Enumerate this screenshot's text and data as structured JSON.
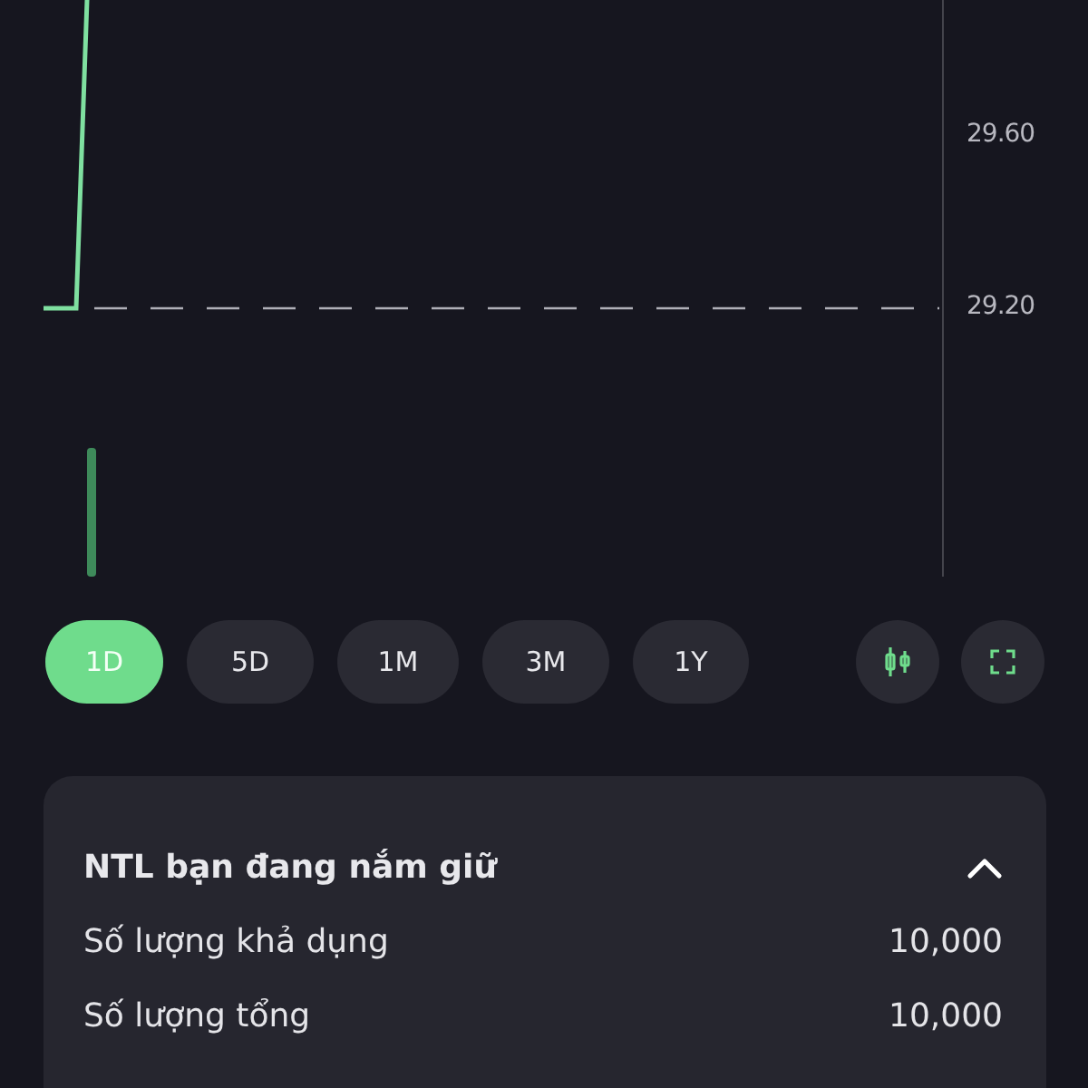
{
  "chart": {
    "price_labels": [
      "29.60",
      "29.20"
    ]
  },
  "ranges": [
    {
      "label": "1D",
      "selected": true
    },
    {
      "label": "5D",
      "selected": false
    },
    {
      "label": "1M",
      "selected": false
    },
    {
      "label": "3M",
      "selected": false
    },
    {
      "label": "1Y",
      "selected": false
    }
  ],
  "holdings": {
    "title": "NTL bạn đang nắm giữ",
    "expanded": true,
    "rows": [
      {
        "label": "Số lượng khả dụng",
        "value": "10,000"
      },
      {
        "label": "Số lượng tổng",
        "value": "10,000"
      }
    ]
  }
}
